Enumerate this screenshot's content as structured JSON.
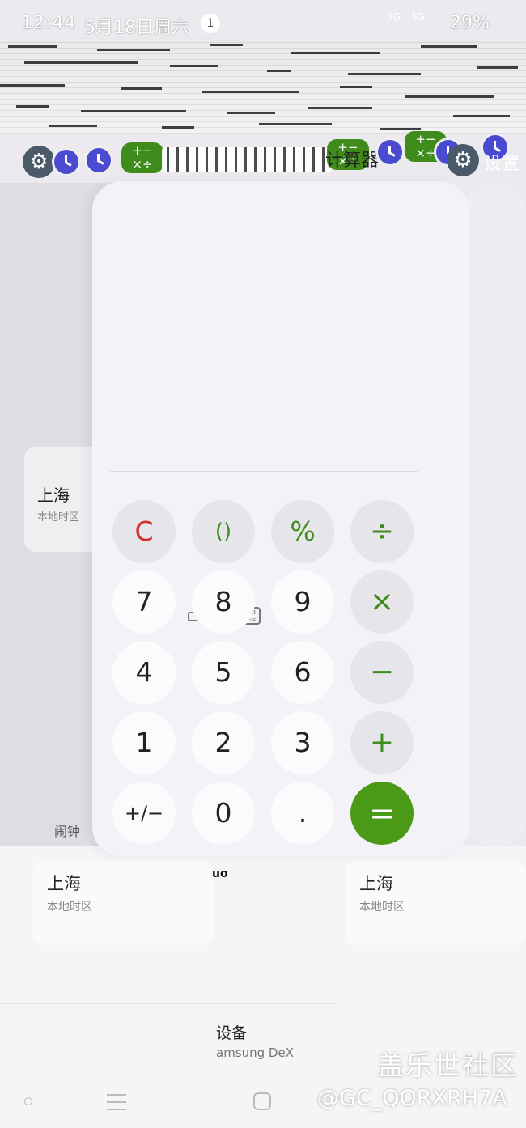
{
  "status_bar": {
    "time": "12:44",
    "date": "5月18日周六",
    "notification_count": "1",
    "signal_1": "5G",
    "signal_2": "5G",
    "battery": "29%"
  },
  "recents": {
    "app_title": "计算器",
    "settings_label": "设置"
  },
  "calculator": {
    "keys": [
      {
        "label": "C"
      },
      {
        "label": "()"
      },
      {
        "label": "%"
      },
      {
        "label": "÷"
      },
      {
        "label": "7"
      },
      {
        "label": "8"
      },
      {
        "label": "9"
      },
      {
        "label": "×"
      },
      {
        "label": "4"
      },
      {
        "label": "5"
      },
      {
        "label": "6"
      },
      {
        "label": "−"
      },
      {
        "label": "1"
      },
      {
        "label": "2"
      },
      {
        "label": "3"
      },
      {
        "label": "+"
      },
      {
        "label": "+/−"
      },
      {
        "label": "0"
      },
      {
        "label": "."
      },
      {
        "label": "="
      }
    ],
    "colors": {
      "accent": "#4a9a18",
      "clear": "#d2312a"
    }
  },
  "background_apps": {
    "clock_left": {
      "city": "上海",
      "timezone": "本地时区",
      "alarm_label": "闹钟"
    },
    "world_cards": [
      {
        "city": "上海",
        "timezone": "本地时区"
      },
      {
        "city": "上海",
        "timezone": "本地时区"
      }
    ],
    "fragment": "uo",
    "dex_title": "设备",
    "dex_subtitle": "amsung DeX"
  },
  "watermark": {
    "line1": "盖乐世社区",
    "line2": "@GC_QORXRH7A"
  }
}
